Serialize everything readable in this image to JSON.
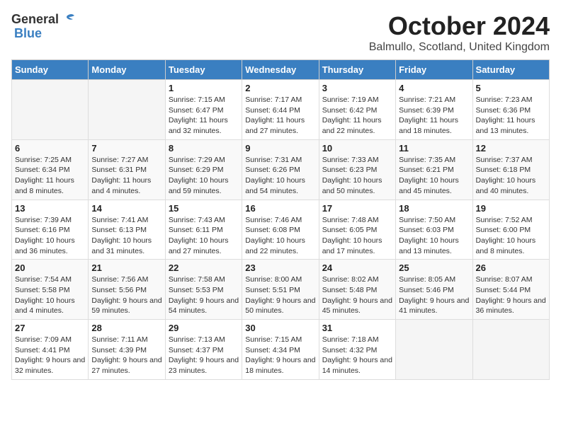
{
  "logo": {
    "general": "General",
    "blue": "Blue"
  },
  "title": "October 2024",
  "subtitle": "Balmullo, Scotland, United Kingdom",
  "days": [
    "Sunday",
    "Monday",
    "Tuesday",
    "Wednesday",
    "Thursday",
    "Friday",
    "Saturday"
  ],
  "weeks": [
    [
      {
        "day": "",
        "sunrise": "",
        "sunset": "",
        "daylight": ""
      },
      {
        "day": "",
        "sunrise": "",
        "sunset": "",
        "daylight": ""
      },
      {
        "day": "1",
        "sunrise": "Sunrise: 7:15 AM",
        "sunset": "Sunset: 6:47 PM",
        "daylight": "Daylight: 11 hours and 32 minutes."
      },
      {
        "day": "2",
        "sunrise": "Sunrise: 7:17 AM",
        "sunset": "Sunset: 6:44 PM",
        "daylight": "Daylight: 11 hours and 27 minutes."
      },
      {
        "day": "3",
        "sunrise": "Sunrise: 7:19 AM",
        "sunset": "Sunset: 6:42 PM",
        "daylight": "Daylight: 11 hours and 22 minutes."
      },
      {
        "day": "4",
        "sunrise": "Sunrise: 7:21 AM",
        "sunset": "Sunset: 6:39 PM",
        "daylight": "Daylight: 11 hours and 18 minutes."
      },
      {
        "day": "5",
        "sunrise": "Sunrise: 7:23 AM",
        "sunset": "Sunset: 6:36 PM",
        "daylight": "Daylight: 11 hours and 13 minutes."
      }
    ],
    [
      {
        "day": "6",
        "sunrise": "Sunrise: 7:25 AM",
        "sunset": "Sunset: 6:34 PM",
        "daylight": "Daylight: 11 hours and 8 minutes."
      },
      {
        "day": "7",
        "sunrise": "Sunrise: 7:27 AM",
        "sunset": "Sunset: 6:31 PM",
        "daylight": "Daylight: 11 hours and 4 minutes."
      },
      {
        "day": "8",
        "sunrise": "Sunrise: 7:29 AM",
        "sunset": "Sunset: 6:29 PM",
        "daylight": "Daylight: 10 hours and 59 minutes."
      },
      {
        "day": "9",
        "sunrise": "Sunrise: 7:31 AM",
        "sunset": "Sunset: 6:26 PM",
        "daylight": "Daylight: 10 hours and 54 minutes."
      },
      {
        "day": "10",
        "sunrise": "Sunrise: 7:33 AM",
        "sunset": "Sunset: 6:23 PM",
        "daylight": "Daylight: 10 hours and 50 minutes."
      },
      {
        "day": "11",
        "sunrise": "Sunrise: 7:35 AM",
        "sunset": "Sunset: 6:21 PM",
        "daylight": "Daylight: 10 hours and 45 minutes."
      },
      {
        "day": "12",
        "sunrise": "Sunrise: 7:37 AM",
        "sunset": "Sunset: 6:18 PM",
        "daylight": "Daylight: 10 hours and 40 minutes."
      }
    ],
    [
      {
        "day": "13",
        "sunrise": "Sunrise: 7:39 AM",
        "sunset": "Sunset: 6:16 PM",
        "daylight": "Daylight: 10 hours and 36 minutes."
      },
      {
        "day": "14",
        "sunrise": "Sunrise: 7:41 AM",
        "sunset": "Sunset: 6:13 PM",
        "daylight": "Daylight: 10 hours and 31 minutes."
      },
      {
        "day": "15",
        "sunrise": "Sunrise: 7:43 AM",
        "sunset": "Sunset: 6:11 PM",
        "daylight": "Daylight: 10 hours and 27 minutes."
      },
      {
        "day": "16",
        "sunrise": "Sunrise: 7:46 AM",
        "sunset": "Sunset: 6:08 PM",
        "daylight": "Daylight: 10 hours and 22 minutes."
      },
      {
        "day": "17",
        "sunrise": "Sunrise: 7:48 AM",
        "sunset": "Sunset: 6:05 PM",
        "daylight": "Daylight: 10 hours and 17 minutes."
      },
      {
        "day": "18",
        "sunrise": "Sunrise: 7:50 AM",
        "sunset": "Sunset: 6:03 PM",
        "daylight": "Daylight: 10 hours and 13 minutes."
      },
      {
        "day": "19",
        "sunrise": "Sunrise: 7:52 AM",
        "sunset": "Sunset: 6:00 PM",
        "daylight": "Daylight: 10 hours and 8 minutes."
      }
    ],
    [
      {
        "day": "20",
        "sunrise": "Sunrise: 7:54 AM",
        "sunset": "Sunset: 5:58 PM",
        "daylight": "Daylight: 10 hours and 4 minutes."
      },
      {
        "day": "21",
        "sunrise": "Sunrise: 7:56 AM",
        "sunset": "Sunset: 5:56 PM",
        "daylight": "Daylight: 9 hours and 59 minutes."
      },
      {
        "day": "22",
        "sunrise": "Sunrise: 7:58 AM",
        "sunset": "Sunset: 5:53 PM",
        "daylight": "Daylight: 9 hours and 54 minutes."
      },
      {
        "day": "23",
        "sunrise": "Sunrise: 8:00 AM",
        "sunset": "Sunset: 5:51 PM",
        "daylight": "Daylight: 9 hours and 50 minutes."
      },
      {
        "day": "24",
        "sunrise": "Sunrise: 8:02 AM",
        "sunset": "Sunset: 5:48 PM",
        "daylight": "Daylight: 9 hours and 45 minutes."
      },
      {
        "day": "25",
        "sunrise": "Sunrise: 8:05 AM",
        "sunset": "Sunset: 5:46 PM",
        "daylight": "Daylight: 9 hours and 41 minutes."
      },
      {
        "day": "26",
        "sunrise": "Sunrise: 8:07 AM",
        "sunset": "Sunset: 5:44 PM",
        "daylight": "Daylight: 9 hours and 36 minutes."
      }
    ],
    [
      {
        "day": "27",
        "sunrise": "Sunrise: 7:09 AM",
        "sunset": "Sunset: 4:41 PM",
        "daylight": "Daylight: 9 hours and 32 minutes."
      },
      {
        "day": "28",
        "sunrise": "Sunrise: 7:11 AM",
        "sunset": "Sunset: 4:39 PM",
        "daylight": "Daylight: 9 hours and 27 minutes."
      },
      {
        "day": "29",
        "sunrise": "Sunrise: 7:13 AM",
        "sunset": "Sunset: 4:37 PM",
        "daylight": "Daylight: 9 hours and 23 minutes."
      },
      {
        "day": "30",
        "sunrise": "Sunrise: 7:15 AM",
        "sunset": "Sunset: 4:34 PM",
        "daylight": "Daylight: 9 hours and 18 minutes."
      },
      {
        "day": "31",
        "sunrise": "Sunrise: 7:18 AM",
        "sunset": "Sunset: 4:32 PM",
        "daylight": "Daylight: 9 hours and 14 minutes."
      },
      {
        "day": "",
        "sunrise": "",
        "sunset": "",
        "daylight": ""
      },
      {
        "day": "",
        "sunrise": "",
        "sunset": "",
        "daylight": ""
      }
    ]
  ]
}
